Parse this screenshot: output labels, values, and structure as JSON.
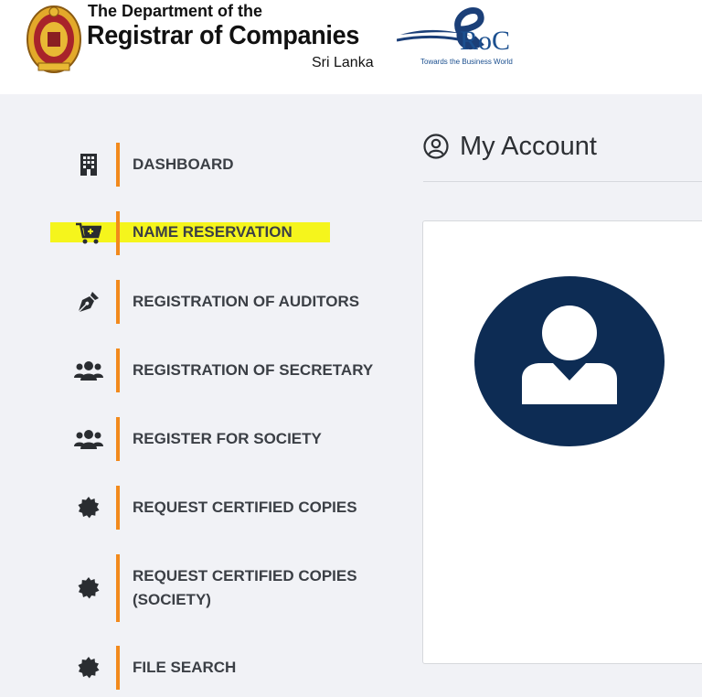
{
  "header": {
    "dept_line1": "The Department of the",
    "dept_line2": "Registrar of Companies",
    "dept_line3": "Sri Lanka",
    "eroc_text": "RoC",
    "eroc_tagline": "Towards the Business World"
  },
  "sidebar": {
    "items": [
      {
        "label": "DASHBOARD",
        "icon": "building-icon"
      },
      {
        "label": "NAME RESERVATION",
        "icon": "cart-icon"
      },
      {
        "label": "REGISTRATION OF AUDITORS",
        "icon": "pen-nib-icon"
      },
      {
        "label": "REGISTRATION OF SECRETARY",
        "icon": "users-icon"
      },
      {
        "label": "REGISTER FOR SOCIETY",
        "icon": "users-icon"
      },
      {
        "label": "REQUEST CERTIFIED COPIES",
        "icon": "certificate-icon"
      },
      {
        "label_line1": "REQUEST CERTIFIED COPIES",
        "label_line2": "(SOCIETY)",
        "icon": "certificate-icon"
      },
      {
        "label": "FILE SEARCH",
        "icon": "certificate-icon"
      }
    ],
    "accent_color": "#f28a1c",
    "highlight_color": "#f5f51c"
  },
  "main": {
    "title": "My Account",
    "title_icon": "user-circle-icon",
    "avatar_color": "#0d2c54"
  }
}
